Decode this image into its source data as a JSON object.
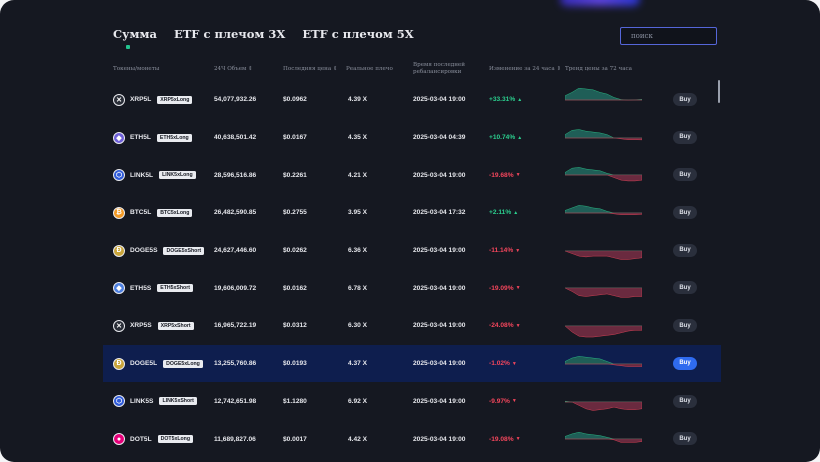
{
  "tabs": [
    {
      "label": "Сумма",
      "active": true
    },
    {
      "label": "ETF с плечом 3X",
      "active": false
    },
    {
      "label": "ETF с плечом 5X",
      "active": false
    }
  ],
  "search": {
    "placeholder": "поиск"
  },
  "table": {
    "headers": {
      "token": "Токены/монеты",
      "volume": "24Ч Объем ⇕",
      "price": "Последняя цена ⇕",
      "leverage": "Реальное плечо",
      "rebalance": "Время последней ребалансировки",
      "change": "Изменение за 24 часа ⇕",
      "trend": "Тренд цены за 72 часа"
    },
    "buy_label": "Buy",
    "rows": [
      {
        "symbol": "XRP5L",
        "badge": "XRP5xLong",
        "volume": "54,077,932.26",
        "price": "$0.0962",
        "leverage": "4.39 X",
        "rebalance": "2025-03-04 19:00",
        "change": "+33.31%",
        "dir": "up",
        "icon": "xrp-icon",
        "icon_glyph": "✕",
        "icon_color": "#2a2e38",
        "trend": [
          5,
          9,
          14,
          13,
          12,
          9,
          7,
          3,
          0.5,
          -0.2,
          0.2,
          0.8
        ]
      },
      {
        "symbol": "ETH5L",
        "badge": "ETH5xLong",
        "volume": "40,638,501.42",
        "price": "$0.0167",
        "leverage": "4.35 X",
        "rebalance": "2025-03-04 04:39",
        "change": "+10.74%",
        "dir": "up",
        "icon": "eth-icon",
        "icon_glyph": "◆",
        "icon_color": "#6e5fd8",
        "trend": [
          4,
          9,
          10,
          8,
          7,
          6,
          4,
          0,
          -1,
          -2,
          -2,
          -2.2
        ]
      },
      {
        "symbol": "LINK5L",
        "badge": "LINK5xLong",
        "volume": "28,596,516.86",
        "price": "$0.2261",
        "leverage": "4.21 X",
        "rebalance": "2025-03-04 19:00",
        "change": "-19.68%",
        "dir": "down",
        "icon": "link-icon",
        "icon_glyph": "⬡",
        "icon_color": "#2f5bd9",
        "trend": [
          3,
          8,
          9,
          7,
          6,
          5,
          2,
          -3,
          -6,
          -7,
          -7,
          -6
        ]
      },
      {
        "symbol": "BTC5L",
        "badge": "BTC5xLong",
        "volume": "26,482,590.85",
        "price": "$0.2755",
        "leverage": "3.95 X",
        "rebalance": "2025-03-04 17:32",
        "change": "+2.11%",
        "dir": "up",
        "icon": "btc-icon",
        "icon_glyph": "₿",
        "icon_color": "#f39a24",
        "trend": [
          3,
          6,
          9,
          8,
          6,
          5,
          2,
          -1,
          -2,
          -2,
          -2,
          -1.5
        ]
      },
      {
        "symbol": "DOGE5S",
        "badge": "DOGE5xShort",
        "volume": "24,627,446.60",
        "price": "$0.0262",
        "leverage": "6.36 X",
        "rebalance": "2025-03-04 19:00",
        "change": "-11.14%",
        "dir": "down",
        "icon": "doge-icon",
        "icon_glyph": "Ð",
        "icon_color": "#c9a53a",
        "trend": [
          0,
          -3,
          -6,
          -7,
          -6,
          -6,
          -6,
          -8,
          -10,
          -10,
          -9,
          -8
        ]
      },
      {
        "symbol": "ETH5S",
        "badge": "ETH5xShort",
        "volume": "19,606,009.72",
        "price": "$0.0162",
        "leverage": "6.78 X",
        "rebalance": "2025-03-04 19:00",
        "change": "-19.09%",
        "dir": "down",
        "icon": "eth-icon",
        "icon_glyph": "◆",
        "icon_color": "#4d7fe0",
        "trend": [
          0,
          -4,
          -9,
          -10,
          -9,
          -8,
          -7,
          -9,
          -11,
          -11,
          -10,
          -10
        ]
      },
      {
        "symbol": "XRP5S",
        "badge": "XRP5xShort",
        "volume": "16,965,722.19",
        "price": "$0.0312",
        "leverage": "6.30 X",
        "rebalance": "2025-03-04 19:00",
        "change": "-24.08%",
        "dir": "down",
        "icon": "xrp-icon",
        "icon_glyph": "✕",
        "icon_color": "#2a2e38",
        "trend": [
          0,
          -7,
          -12,
          -13,
          -13,
          -12,
          -11,
          -10,
          -8,
          -6,
          -5,
          -5
        ]
      },
      {
        "symbol": "DOGE5L",
        "badge": "DOGE5xLong",
        "volume": "13,255,760.86",
        "price": "$0.0193",
        "leverage": "4.37 X",
        "rebalance": "2025-03-04 19:00",
        "change": "-1.02%",
        "dir": "down",
        "icon": "doge-icon",
        "icon_glyph": "Ð",
        "icon_color": "#c9a53a",
        "trend": [
          3,
          7,
          9,
          8,
          7,
          6,
          3,
          -1,
          -2,
          -3,
          -3,
          -3
        ],
        "highlight": true
      },
      {
        "symbol": "LINK5S",
        "badge": "LINK5xShort",
        "volume": "12,742,651.98",
        "price": "$1.1280",
        "leverage": "6.92 X",
        "rebalance": "2025-03-04 19:00",
        "change": "-9.97%",
        "dir": "down",
        "icon": "link-icon",
        "icon_glyph": "⬡",
        "icon_color": "#2f5bd9",
        "trend": [
          1,
          0,
          -4,
          -8,
          -10,
          -9,
          -8,
          -6,
          -8,
          -9,
          -9,
          -8
        ]
      },
      {
        "symbol": "DOT5L",
        "badge": "DOT5xLong",
        "volume": "11,689,827.06",
        "price": "$0.0017",
        "leverage": "4.42 X",
        "rebalance": "2025-03-04 19:00",
        "change": "-19.08%",
        "dir": "down",
        "icon": "dot-icon",
        "icon_glyph": "●",
        "icon_color": "#e6007a",
        "trend": [
          3,
          6,
          8,
          6,
          5,
          4,
          2,
          -1,
          -4,
          -4,
          -4,
          -3
        ]
      }
    ]
  },
  "colors": {
    "up": "#2bd08f",
    "down": "#f4465c",
    "area_up": "#1f5e57",
    "area_down": "#6a2a3f"
  }
}
